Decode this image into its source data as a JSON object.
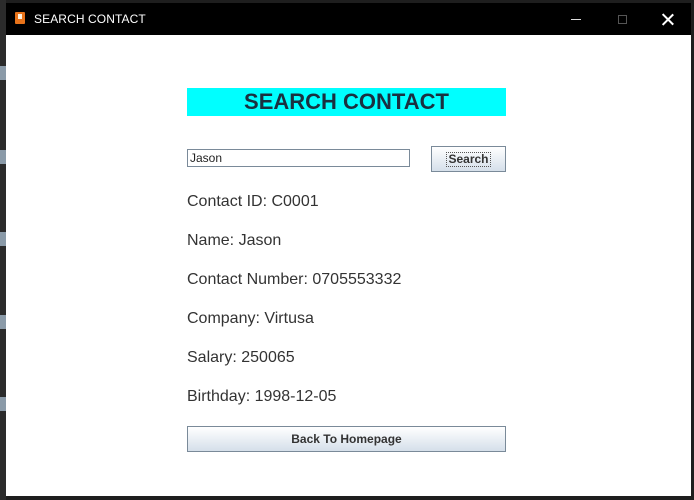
{
  "window": {
    "title": "SEARCH CONTACT"
  },
  "heading": "SEARCH CONTACT",
  "search": {
    "value": "Jason",
    "button_label": "Search"
  },
  "contact": {
    "id_line": "Contact ID: C0001",
    "name_line": "Name: Jason",
    "number_line": "Contact Number: 0705553332",
    "company_line": "Company: Virtusa",
    "salary_line": "Salary: 250065",
    "birthday_line": "Birthday: 1998-12-05"
  },
  "back_button_label": "Back To Homepage",
  "colors": {
    "heading_background": "#00ffff",
    "titlebar": "#000000"
  }
}
